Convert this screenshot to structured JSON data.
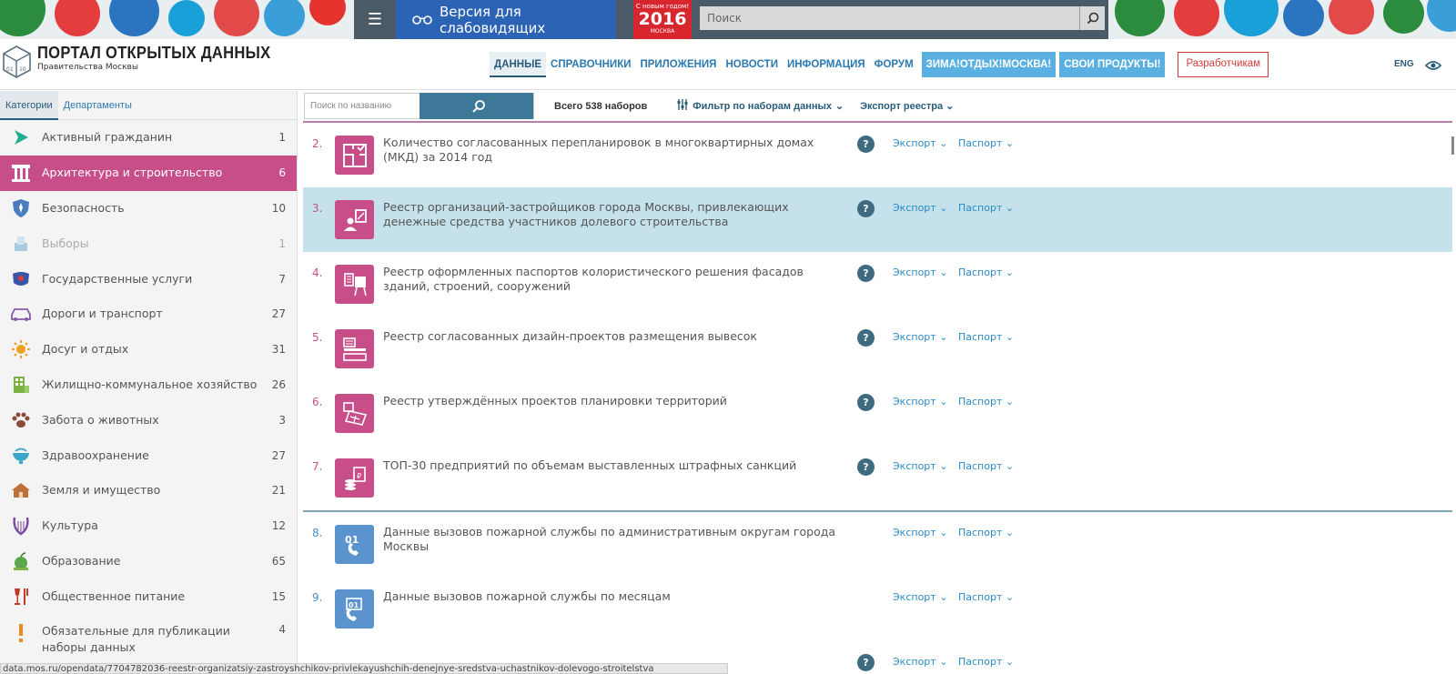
{
  "banner": {
    "vision_label": "Версия для слабовидящих",
    "logo_top": "С новым годом!",
    "logo_year": "2016",
    "logo_city": "МОСКВА",
    "search_placeholder": "Поиск"
  },
  "header": {
    "title": "ПОРТАЛ ОТКРЫТЫХ ДАННЫХ",
    "subtitle": "Правительства Москвы",
    "nav": [
      {
        "label": "ДАННЫЕ"
      },
      {
        "label": "СПРАВОЧНИКИ"
      },
      {
        "label": "ПРИЛОЖЕНИЯ"
      },
      {
        "label": "НОВОСТИ"
      },
      {
        "label": "ИНФОРМАЦИЯ"
      },
      {
        "label": "ФОРУМ"
      },
      {
        "label": "ЗИМА!ОТДЫХ!МОСКВА!"
      },
      {
        "label": "СВОИ ПРОДУКТЫ!"
      },
      {
        "label": "Разработчикам"
      }
    ],
    "lang": "ENG"
  },
  "sidebar": {
    "tabs": [
      "Категории",
      "Департаменты"
    ],
    "categories": [
      {
        "label": "Активный гражданин",
        "count": "1"
      },
      {
        "label": "Архитектура и строительство",
        "count": "6"
      },
      {
        "label": "Безопасность",
        "count": "10"
      },
      {
        "label": "Выборы",
        "count": "1"
      },
      {
        "label": "Государственные услуги",
        "count": "7"
      },
      {
        "label": "Дороги и транспорт",
        "count": "27"
      },
      {
        "label": "Досуг и отдых",
        "count": "31"
      },
      {
        "label": "Жилищно-коммунальное хозяйство",
        "count": "26"
      },
      {
        "label": "Забота о животных",
        "count": "3"
      },
      {
        "label": "Здравоохранение",
        "count": "27"
      },
      {
        "label": "Земля и имущество",
        "count": "21"
      },
      {
        "label": "Культура",
        "count": "12"
      },
      {
        "label": "Образование",
        "count": "65"
      },
      {
        "label": "Общественное питание",
        "count": "15"
      },
      {
        "label": "Обязательные для публикации наборы данных",
        "count": "4"
      }
    ]
  },
  "toolbar": {
    "search_placeholder": "Поиск по названию",
    "total": "Всего 538 наборов",
    "filter": "Фильтр по наборам данных",
    "export": "Экспорт реестра"
  },
  "datasets": [
    {
      "num": "2.",
      "title": "Количество согласованных перепланировок в многоквартирных домах (МКД) за 2014 год",
      "export": "Экспорт",
      "passport": "Паспорт"
    },
    {
      "num": "3.",
      "title": "Реестр организаций-застройщиков города Москвы, привлекающих денежные средства участников долевого строительства",
      "export": "Экспорт",
      "passport": "Паспорт"
    },
    {
      "num": "4.",
      "title": "Реестр оформленных паспортов колористического решения фасадов зданий, строений, сооружений",
      "export": "Экспорт",
      "passport": "Паспорт"
    },
    {
      "num": "5.",
      "title": "Реестр согласованных дизайн-проектов размещения вывесок",
      "export": "Экспорт",
      "passport": "Паспорт"
    },
    {
      "num": "6.",
      "title": "Реестр утверждённых проектов планировки территорий",
      "export": "Экспорт",
      "passport": "Паспорт"
    },
    {
      "num": "7.",
      "title": "ТОП-30 предприятий по объемам выставленных штрафных санкций",
      "export": "Экспорт",
      "passport": "Паспорт"
    },
    {
      "num": "8.",
      "title": "Данные вызовов пожарной службы по административным округам города Москвы",
      "export": "Экспорт",
      "passport": "Паспорт"
    },
    {
      "num": "9.",
      "title": "Данные вызовов пожарной службы по месяцам",
      "export": "Экспорт",
      "passport": "Паспорт"
    },
    {
      "num": "",
      "title": "",
      "export": "Экспорт",
      "passport": "Паспорт"
    }
  ],
  "status_url": "data.mos.ru/opendata/7704782036-reestr-organizatsiy-zastroyshchikov-privlekayushchih-denejnye-sredstva-uchastnikov-dolevogo-stroitelstva",
  "colors": {
    "accent_pink": "#c84e8a",
    "accent_blue": "#2a7ab0",
    "highlight": "#c5e2ec",
    "fire_blue": "#5b93cf"
  }
}
